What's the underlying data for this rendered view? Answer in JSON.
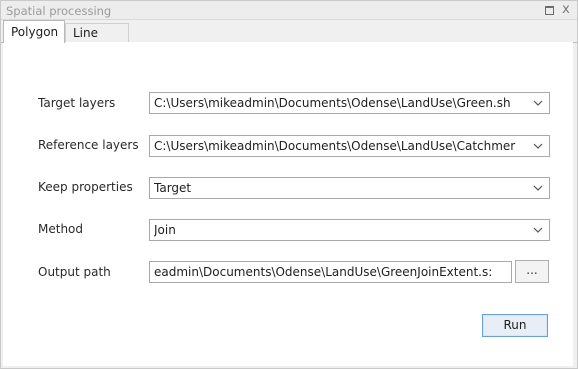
{
  "window": {
    "title": "Spatial processing",
    "restore_icon": "restore-window-icon",
    "close_glyph": "x"
  },
  "tabs": [
    {
      "label": "Polygon",
      "active": true
    },
    {
      "label": "Line",
      "active": false
    }
  ],
  "form": {
    "target_layers": {
      "label": "Target layers",
      "value": "C:\\Users\\mikeadmin\\Documents\\Odense\\LandUse\\Green.sh"
    },
    "reference_layers": {
      "label": "Reference layers",
      "value": "C:\\Users\\mikeadmin\\Documents\\Odense\\LandUse\\Catchmer"
    },
    "keep_properties": {
      "label": "Keep properties",
      "value": "Target"
    },
    "method": {
      "label": "Method",
      "value": "Join"
    },
    "output_path": {
      "label": "Output path",
      "value": ":eadmin\\Documents\\Odense\\LandUse\\GreenJoinExtent.s"
    }
  },
  "buttons": {
    "browse_label": "...",
    "run_label": "Run"
  },
  "colors": {
    "run_border": "#6aa0d8",
    "run_fill": "#e7eef6"
  }
}
